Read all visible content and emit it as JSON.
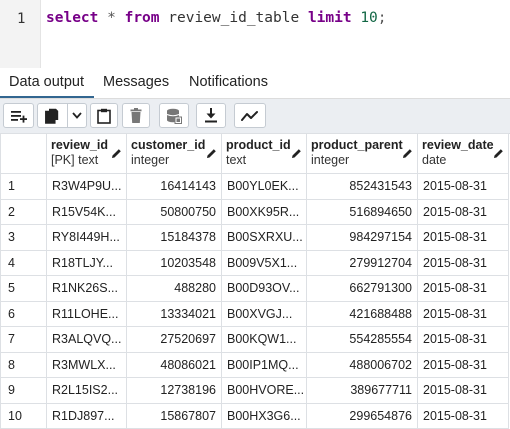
{
  "editor": {
    "line_number": "1",
    "tokens": {
      "select": "select",
      "star": "*",
      "from": "from",
      "table": "review_id_table",
      "limit": "limit",
      "n": "10",
      "semi": ";"
    }
  },
  "tabs": [
    {
      "label": "Data output",
      "active": true
    },
    {
      "label": "Messages",
      "active": false
    },
    {
      "label": "Notifications",
      "active": false
    }
  ],
  "toolbar": {
    "icons": [
      "add-row-icon",
      "copy-icon",
      "chevron-down-icon",
      "paste-icon",
      "delete-icon",
      "save-data-icon",
      "download-icon",
      "graph-icon"
    ]
  },
  "grid": {
    "columns": [
      {
        "name": "review_id",
        "type": "[PK] text"
      },
      {
        "name": "customer_id",
        "type": "integer"
      },
      {
        "name": "product_id",
        "type": "text"
      },
      {
        "name": "product_parent",
        "type": "integer"
      },
      {
        "name": "review_date",
        "type": "date"
      }
    ],
    "rows": [
      [
        "1",
        "R3W4P9U...",
        "16414143",
        "B00YL0EK...",
        "852431543",
        "2015-08-31"
      ],
      [
        "2",
        "R15V54K...",
        "50800750",
        "B00XK95R...",
        "516894650",
        "2015-08-31"
      ],
      [
        "3",
        "RY8I449H...",
        "15184378",
        "B00SXRXU...",
        "984297154",
        "2015-08-31"
      ],
      [
        "4",
        "R18TLJY...",
        "10203548",
        "B009V5X1...",
        "279912704",
        "2015-08-31"
      ],
      [
        "5",
        "R1NK26S...",
        "488280",
        "B00D93OV...",
        "662791300",
        "2015-08-31"
      ],
      [
        "6",
        "R11LOHE...",
        "13334021",
        "B00XVGJ...",
        "421688488",
        "2015-08-31"
      ],
      [
        "7",
        "R3ALQVQ...",
        "27520697",
        "B00KQW1...",
        "554285554",
        "2015-08-31"
      ],
      [
        "8",
        "R3MWLX...",
        "48086021",
        "B00IP1MQ...",
        "488006702",
        "2015-08-31"
      ],
      [
        "9",
        "R2L15IS2...",
        "12738196",
        "B00HVORE...",
        "389677711",
        "2015-08-31"
      ],
      [
        "10",
        "R1DJ897...",
        "15867807",
        "B00HX3G6...",
        "299654876",
        "2015-08-31"
      ]
    ]
  }
}
